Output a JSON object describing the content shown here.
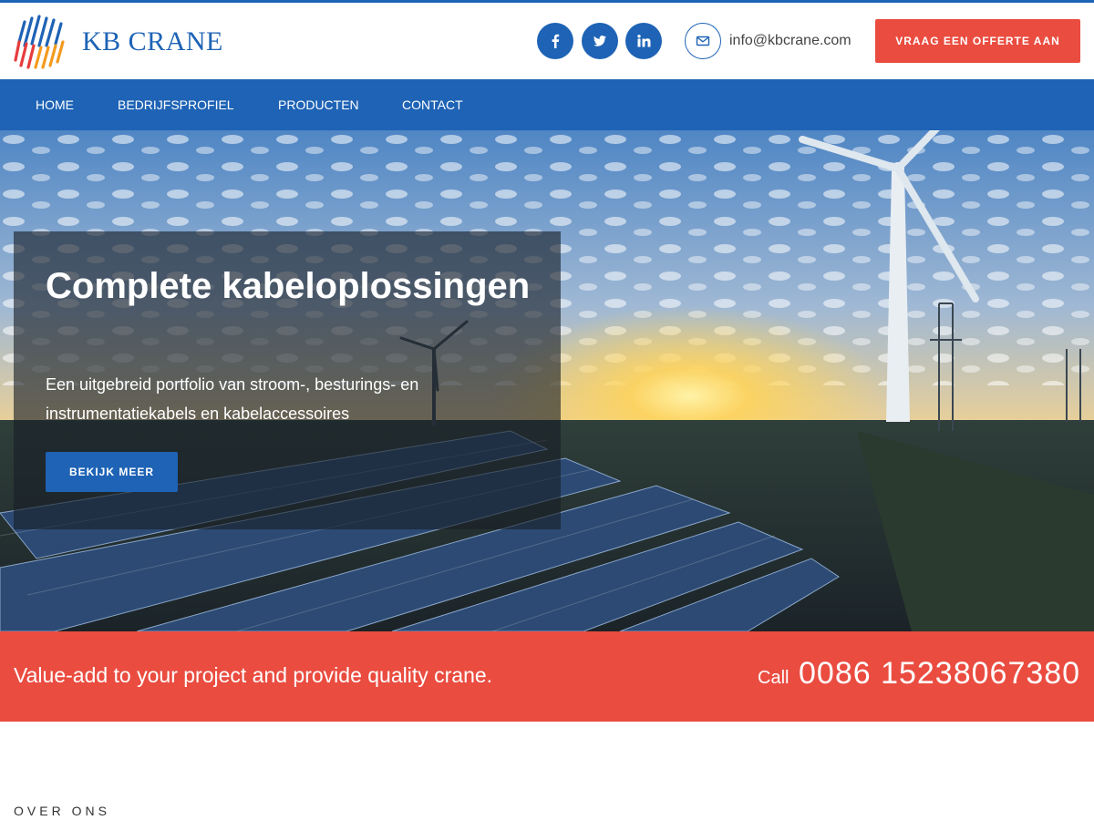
{
  "header": {
    "brand": "KB CRANE",
    "email": "info@kbcrane.com",
    "quote_button": "VRAAG EEN OFFERTE AAN",
    "social_icons": [
      "facebook-icon",
      "twitter-icon",
      "linkedin-icon"
    ]
  },
  "nav": {
    "items": [
      {
        "label": "HOME"
      },
      {
        "label": "BEDRIJFSPROFIEL"
      },
      {
        "label": "PRODUCTEN"
      },
      {
        "label": "CONTACT"
      }
    ]
  },
  "hero": {
    "title": "Complete kabeloplossingen",
    "subtitle": "Een uitgebreid portfolio van stroom-, besturings- en instrumentatiekabels en kabelaccessoires",
    "button": "BEKIJK MEER"
  },
  "cta": {
    "text": "Value-add to your project and provide quality crane.",
    "call_label": "Call",
    "phone": "0086 15238067380"
  },
  "about": {
    "label": "OVER ONS"
  },
  "colors": {
    "primary": "#1e63b5",
    "accent": "#ea4c40",
    "white": "#ffffff"
  }
}
